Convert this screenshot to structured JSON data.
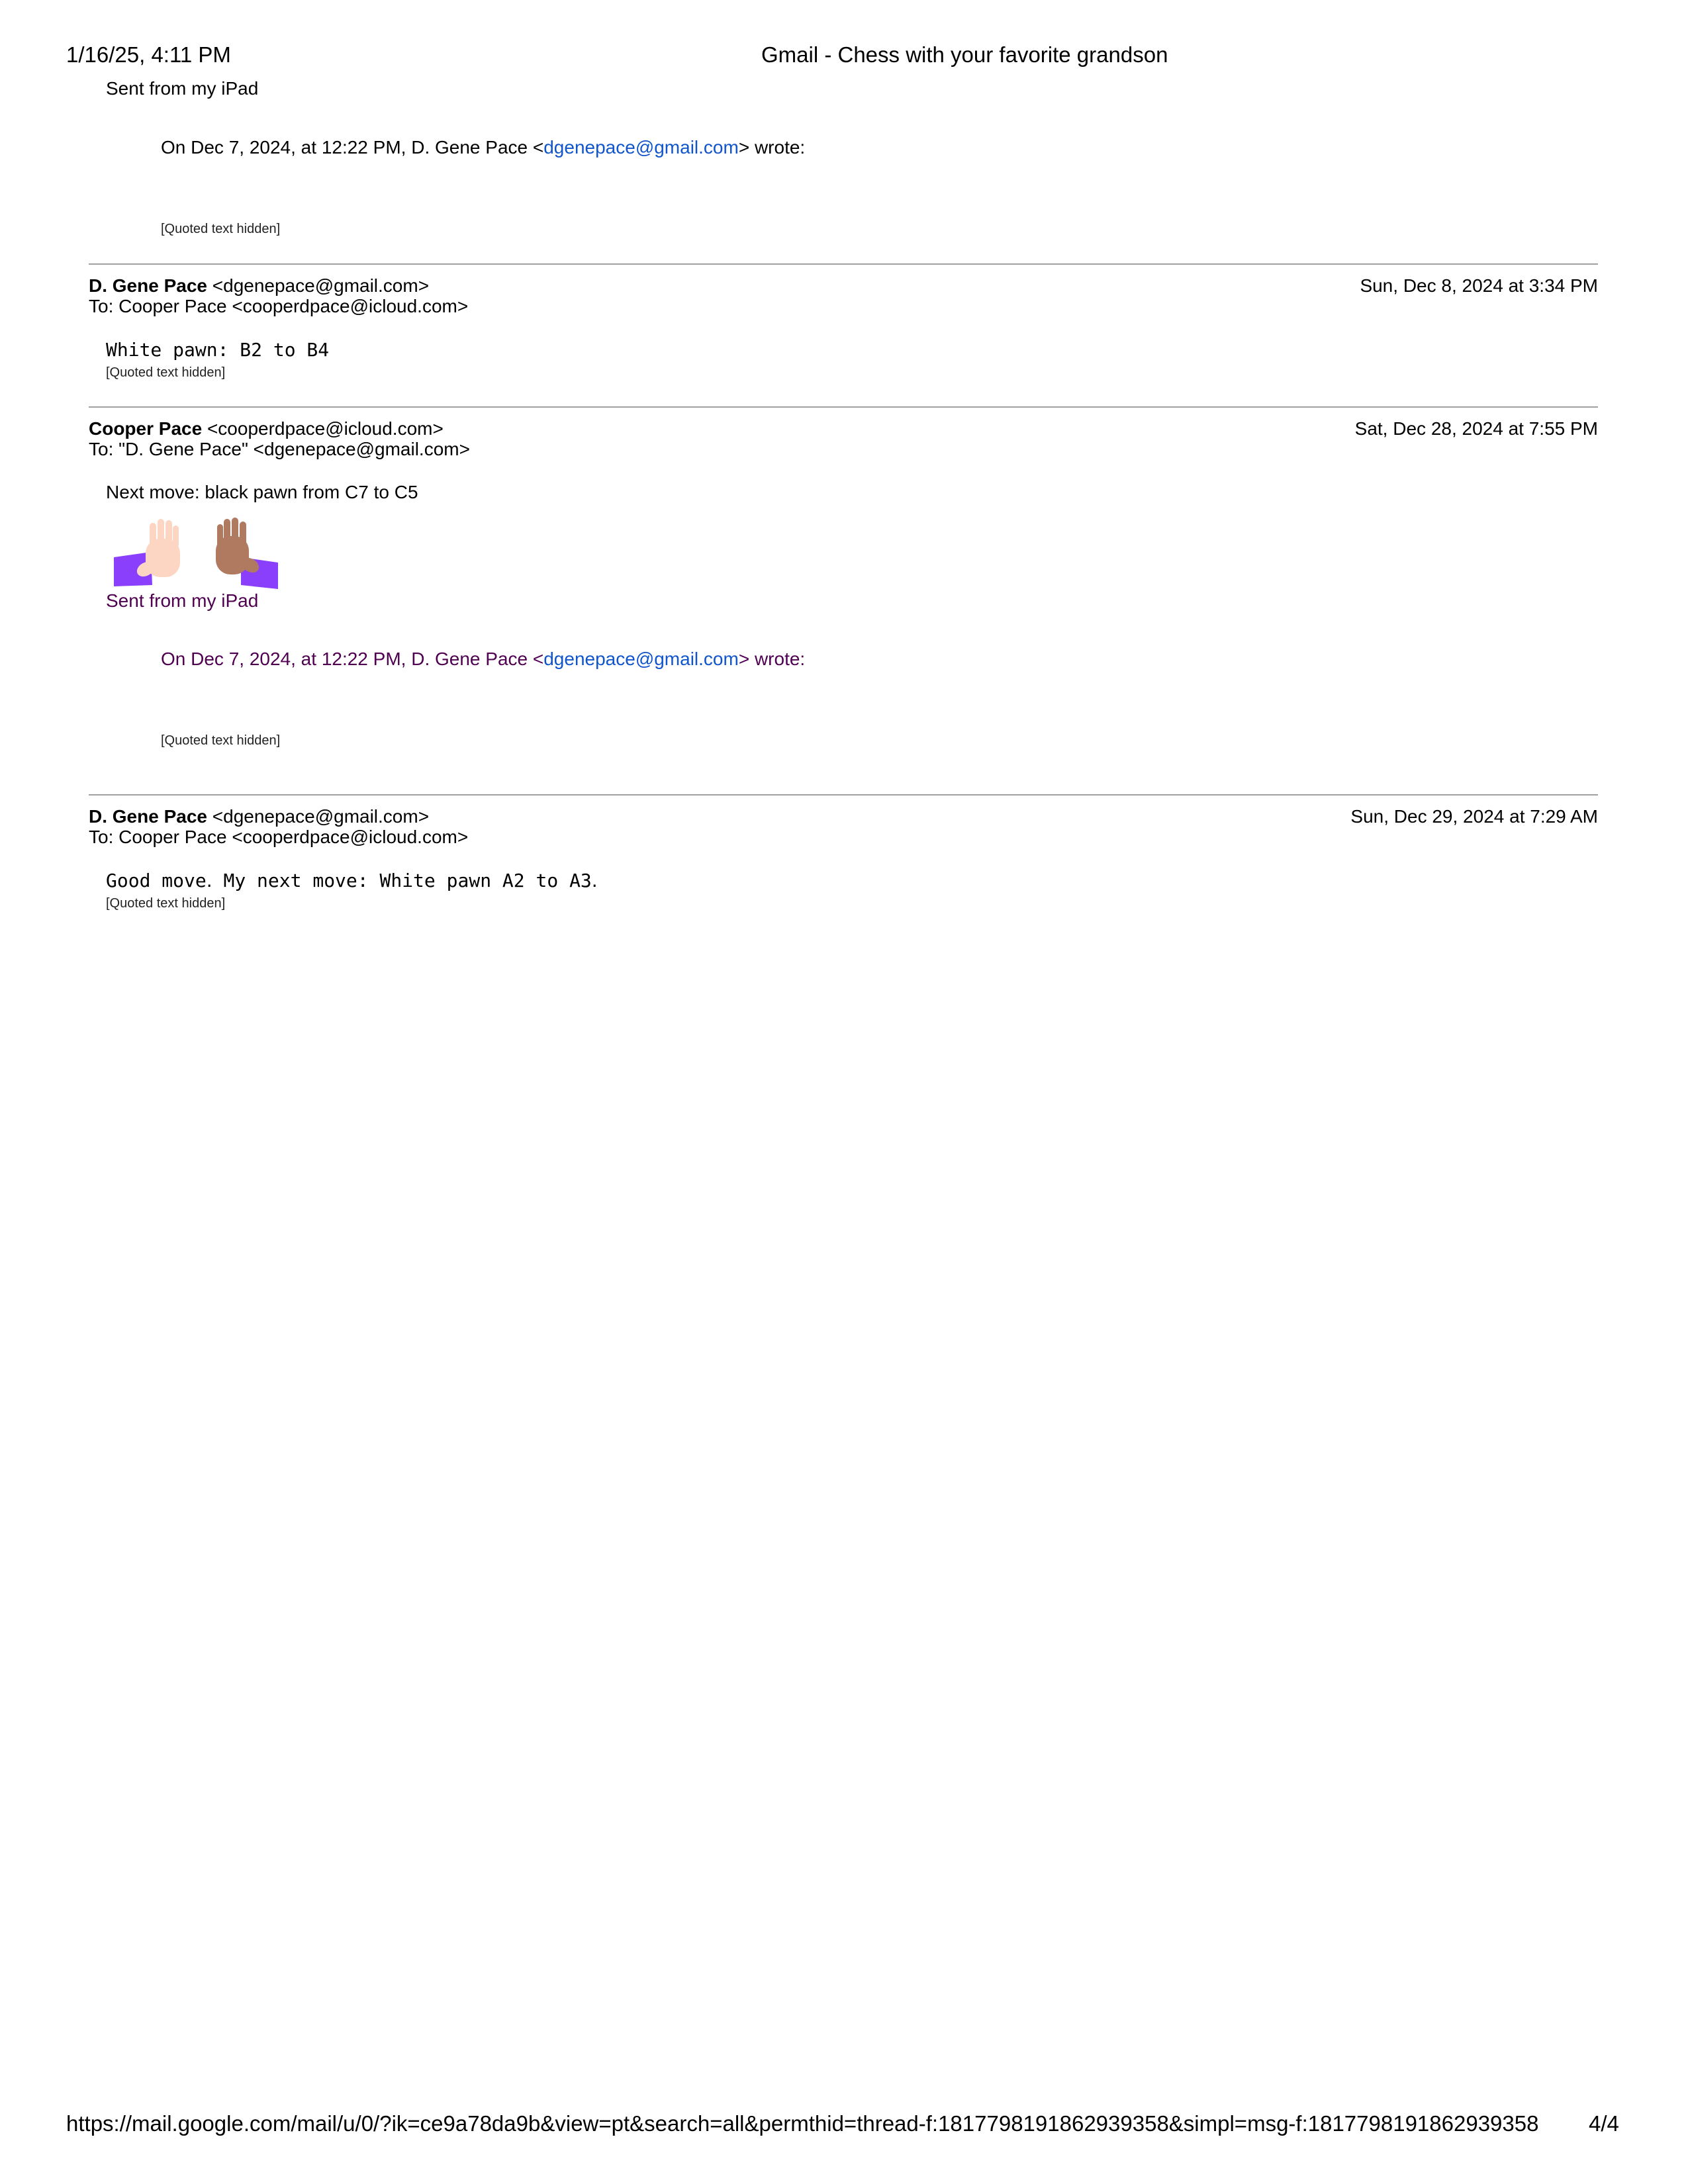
{
  "page_header": {
    "datetime": "1/16/25, 4:11 PM",
    "title": "Gmail - Chess with your favorite grandson"
  },
  "top_fragment": {
    "sent_from": "Sent from my iPad",
    "quote_prefix": "On Dec 7, 2024, at 12:22 PM, D. Gene Pace <",
    "quote_email": "dgenepace@gmail.com",
    "quote_suffix": "> wrote:",
    "quoted_hidden": "[Quoted text hidden]"
  },
  "messages": [
    {
      "sender_name": "D. Gene Pace",
      "sender_email": "<dgenepace@gmail.com>",
      "date": "Sun, Dec 8, 2024 at 3:34 PM",
      "to": "To: Cooper Pace <cooperdpace@icloud.com>",
      "body": "White pawn: B2 to B4",
      "quoted_hidden": "[Quoted text hidden]"
    },
    {
      "sender_name": "Cooper Pace",
      "sender_email": "<cooperdpace@icloud.com>",
      "date": "Sat, Dec 28, 2024 at 7:55 PM",
      "to": "To: \"D. Gene Pace\" <dgenepace@gmail.com>",
      "body": "Next move:  black pawn from C7 to C5",
      "emoji": "high-five-emoji",
      "sent_from": "Sent from my iPad",
      "quote_prefix": "On Dec 7, 2024, at 12:22 PM, D. Gene Pace <",
      "quote_email": "dgenepace@gmail.com",
      "quote_suffix": "> wrote:",
      "quoted_hidden": "[Quoted text hidden]"
    },
    {
      "sender_name": "D. Gene Pace",
      "sender_email": "<dgenepace@gmail.com>",
      "date": "Sun, Dec 29, 2024 at 7:29 AM",
      "to": "To: Cooper Pace <cooperdpace@icloud.com>",
      "body_start": "Good move",
      "body_dot1": ".",
      "body_middle": " My next move: White pawn A2 to A3",
      "body_dot2": ".",
      "quoted_hidden": "[Quoted text hidden]"
    }
  ],
  "page_footer": {
    "url": "https://mail.google.com/mail/u/0/?ik=ce9a78da9b&view=pt&search=all&permthid=thread-f:1817798191862939358&simpl=msg-f:1817798191862939358",
    "page": "4/4"
  },
  "colors": {
    "link": "#1155cc",
    "quoted_purple": "#500050",
    "divider": "#a0a0a0"
  }
}
